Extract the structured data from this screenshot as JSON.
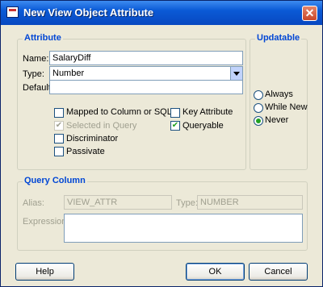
{
  "window": {
    "title": "New View Object Attribute",
    "close_glyph": "✕"
  },
  "attribute": {
    "legend": "Attribute",
    "name_label": "Name:",
    "name_value": "SalaryDiff",
    "type_label": "Type:",
    "type_value": "Number",
    "default_label": "Default:",
    "default_value": "",
    "checks": [
      {
        "label": "Mapped to Column or SQL",
        "checked": false,
        "disabled": false
      },
      {
        "label": "Selected in Query",
        "checked": true,
        "disabled": true
      },
      {
        "label": "Discriminator",
        "checked": false,
        "disabled": false
      },
      {
        "label": "Passivate",
        "checked": false,
        "disabled": false
      },
      {
        "label": "Key Attribute",
        "checked": false,
        "disabled": false
      },
      {
        "label": "Queryable",
        "checked": true,
        "disabled": false
      }
    ]
  },
  "updatable": {
    "legend": "Updatable",
    "options": [
      {
        "label": "Always",
        "selected": false
      },
      {
        "label": "While New",
        "selected": false
      },
      {
        "label": "Never",
        "selected": true
      }
    ]
  },
  "query_column": {
    "legend": "Query Column",
    "alias_label": "Alias:",
    "alias_value": "VIEW_ATTR",
    "type_label": "Type:",
    "type_value": "NUMBER",
    "expression_label": "Expression:",
    "expression_value": ""
  },
  "buttons": {
    "help": "Help",
    "ok": "OK",
    "cancel": "Cancel"
  },
  "check_glyph": "✔"
}
